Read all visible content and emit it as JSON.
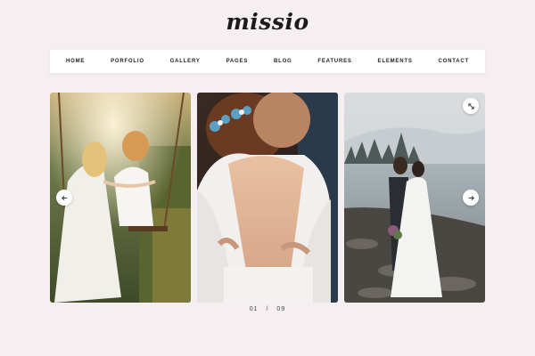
{
  "brand": {
    "logo_text": "missio"
  },
  "nav": {
    "items": [
      {
        "label": "HOME"
      },
      {
        "label": "PORFOLIO"
      },
      {
        "label": "GALLERY"
      },
      {
        "label": "PAGES"
      },
      {
        "label": "BLOG"
      },
      {
        "label": "FEATURES"
      },
      {
        "label": "ELEMENTS"
      },
      {
        "label": "CONTACT"
      }
    ]
  },
  "slider": {
    "current": "01",
    "separator": "/",
    "total": "09",
    "icons": {
      "prev": "arrow-left-icon",
      "next": "arrow-right-icon",
      "expand": "expand-icon"
    }
  },
  "colors": {
    "background": "#f6eff2",
    "nav_background": "#ffffff",
    "text": "#222222"
  }
}
